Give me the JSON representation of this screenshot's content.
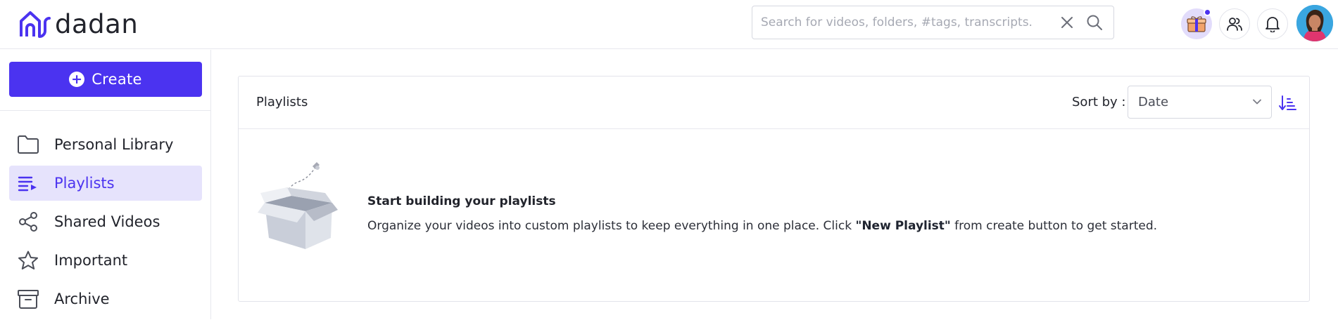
{
  "brand": {
    "name": "dadan"
  },
  "search": {
    "placeholder": "Search for videos, folders, #tags, transcripts.",
    "value": ""
  },
  "header_icons": [
    "gift-icon",
    "users-icon",
    "bell-icon",
    "avatar"
  ],
  "sidebar": {
    "create_label": "Create",
    "items": [
      {
        "label": "Personal Library",
        "icon": "folder-icon",
        "active": false
      },
      {
        "label": "Playlists",
        "icon": "playlist-icon",
        "active": true
      },
      {
        "label": "Shared Videos",
        "icon": "share-icon",
        "active": false
      },
      {
        "label": "Important",
        "icon": "star-icon",
        "active": false
      },
      {
        "label": "Archive",
        "icon": "archive-icon",
        "active": false
      }
    ]
  },
  "main": {
    "title": "Playlists",
    "sort_label": "Sort by :",
    "sort_value": "Date",
    "empty": {
      "title": "Start building your playlists",
      "desc_before": "Organize your videos into custom playlists to keep everything in one place. Click ",
      "desc_bold": "\"New Playlist\"",
      "desc_after": " from create button to get started."
    }
  },
  "colors": {
    "accent": "#4b33f0",
    "active_bg": "#e6e3fc",
    "border": "#e2e3ea"
  }
}
